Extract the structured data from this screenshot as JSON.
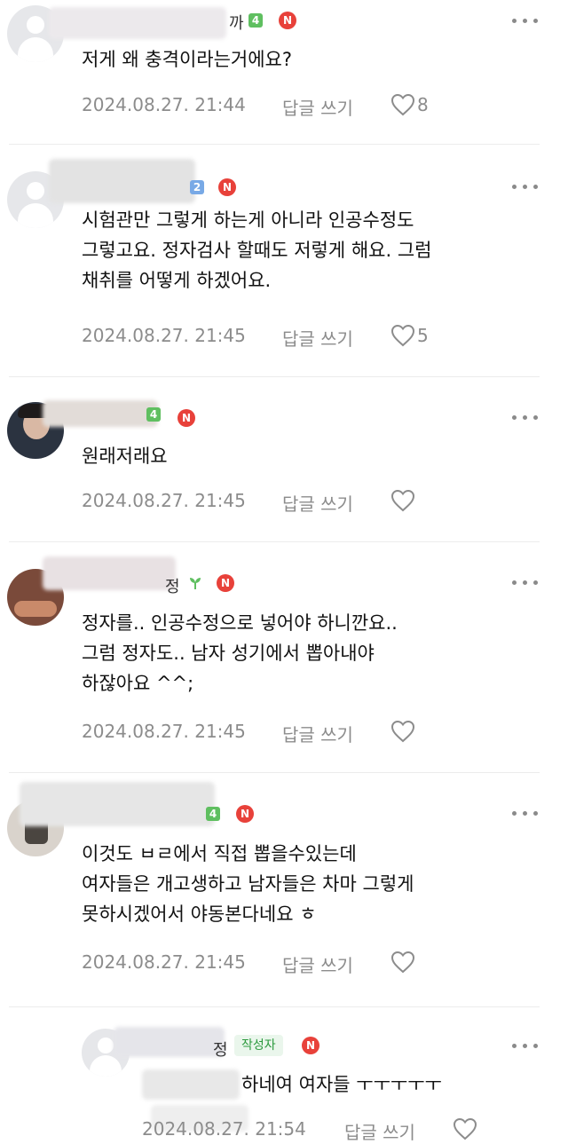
{
  "comments": [
    {
      "nick_tail": "까",
      "level": "4",
      "badge": "N",
      "text": "저게 왜 충격이라는거에요?",
      "date": "2024.08.27. 21:44",
      "reply_label": "답글 쓰기",
      "likes": "8"
    },
    {
      "level": "2",
      "badge": "N",
      "text": "시험관만 그렇게 하는게 아니라 인공수정도\n그렇고요. 정자검사 할때도 저렇게 해요. 그럼\n채취를 어떻게 하겠어요.",
      "date": "2024.08.27. 21:45",
      "reply_label": "답글 쓰기",
      "likes": "5"
    },
    {
      "level": "4",
      "badge": "N",
      "text": "원래저래요",
      "date": "2024.08.27. 21:45",
      "reply_label": "답글 쓰기",
      "likes": ""
    },
    {
      "nick_tail": "정",
      "badge": "N",
      "text": "정자를.. 인공수정으로 넣어야 하니깐요..\n그럼 정자도.. 남자 성기에서 뽑아내야\n하잖아요 ^^;",
      "date": "2024.08.27. 21:45",
      "reply_label": "답글 쓰기",
      "likes": ""
    },
    {
      "level": "4",
      "badge": "N",
      "text": "이것도 ㅂㄹ에서 직접 뽑을수있는데\n여자들은 개고생하고 남자들은 차마 그렇게\n못하시겠어서 야동본다네요 ㅎ",
      "date": "2024.08.27. 21:45",
      "reply_label": "답글 쓰기",
      "likes": ""
    },
    {
      "nick_tail": "정",
      "author_tag": "작성자",
      "badge": "N",
      "text_visible": "하네여 여자들 ㅜㅜㅜㅜㅜ",
      "date": "2024.08.27. 21:54",
      "reply_label": "답글 쓰기",
      "likes": ""
    }
  ],
  "colors": {
    "badge": "#e8413a",
    "level_green": "#5fbf60",
    "meta_gray": "#8c8c8c",
    "author_green": "#2c9a3e"
  },
  "icons": {
    "more": "more-dots-icon",
    "like": "heart-icon",
    "badge": "n-badge-icon"
  }
}
